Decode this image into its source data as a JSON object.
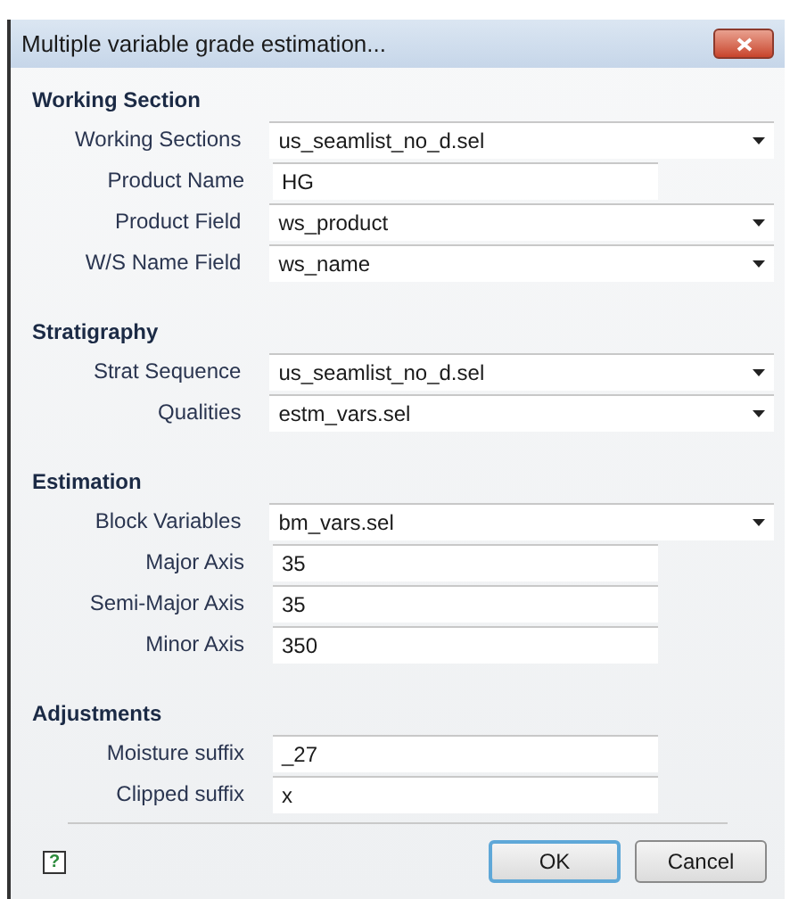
{
  "window": {
    "title": "Multiple variable grade estimation..."
  },
  "sections": [
    {
      "title": "Working Section",
      "fields": [
        {
          "label": "Working Sections",
          "value": "us_seamlist_no_d.sel",
          "kind": "dropdown"
        },
        {
          "label": "Product Name",
          "value": "HG",
          "kind": "text"
        },
        {
          "label": "Product Field",
          "value": "ws_product",
          "kind": "dropdown"
        },
        {
          "label": "W/S Name Field",
          "value": "ws_name",
          "kind": "dropdown"
        }
      ]
    },
    {
      "title": "Stratigraphy",
      "fields": [
        {
          "label": "Strat Sequence",
          "value": "us_seamlist_no_d.sel",
          "kind": "dropdown"
        },
        {
          "label": "Qualities",
          "value": "estm_vars.sel",
          "kind": "dropdown"
        }
      ]
    },
    {
      "title": "Estimation",
      "fields": [
        {
          "label": "Block Variables",
          "value": "bm_vars.sel",
          "kind": "dropdown"
        },
        {
          "label": "Major Axis",
          "value": "35",
          "kind": "text"
        },
        {
          "label": "Semi-Major Axis",
          "value": "35",
          "kind": "text"
        },
        {
          "label": "Minor Axis",
          "value": "350",
          "kind": "text"
        }
      ]
    },
    {
      "title": "Adjustments",
      "fields": [
        {
          "label": "Moisture suffix",
          "value": "_27",
          "kind": "text"
        },
        {
          "label": "Clipped suffix",
          "value": "x",
          "kind": "text"
        }
      ]
    }
  ],
  "help_button": "?",
  "buttons": [
    {
      "label": "OK",
      "kind": "default"
    },
    {
      "label": "Cancel",
      "kind": "normal"
    }
  ]
}
